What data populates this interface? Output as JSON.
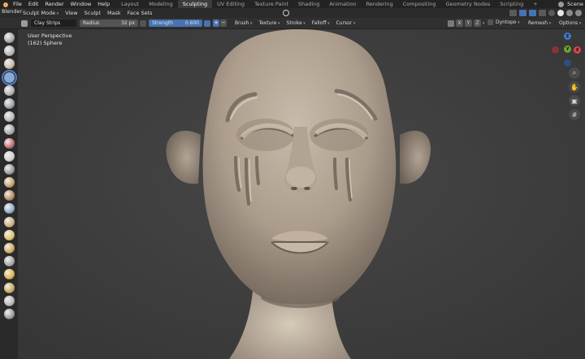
{
  "app": {
    "name": "Blender",
    "scene_label": "Scene"
  },
  "menubar": {
    "items": [
      "File",
      "Edit",
      "Render",
      "Window",
      "Help"
    ],
    "workspaces": [
      "Layout",
      "Modeling",
      "Sculpting",
      "UV Editing",
      "Texture Paint",
      "Shading",
      "Animation",
      "Rendering",
      "Compositing",
      "Geometry Nodes",
      "Scripting"
    ],
    "active_workspace": "Sculpting",
    "add_tab": "+"
  },
  "header": {
    "mode": "Sculpt Mode",
    "menus": [
      "View",
      "Sculpt",
      "Mask",
      "Face Sets"
    ]
  },
  "toolsettings": {
    "brush_name": "Clay Strips",
    "radius_label": "Radius",
    "radius_value": "32 px",
    "strength_label": "Strength",
    "strength_value": "0.600",
    "plus": "+",
    "minus": "−",
    "menus": [
      "Brush",
      "Texture",
      "Stroke",
      "Falloff",
      "Cursor"
    ],
    "symmetry": [
      "X",
      "Y",
      "Z"
    ],
    "dyntopo_label": "Dyntopo",
    "remesh_label": "Remesh",
    "options_label": "Options"
  },
  "viewport": {
    "perspective": "User Perspective",
    "object": "(162) Sphere",
    "background": "#3e3e3e",
    "mesh_color": "#b7a898"
  },
  "gizmo": {
    "x_label": "X",
    "y_label": "Y",
    "z_label": "Z",
    "x_color": "#d9464a",
    "y_color": "#6ea52d",
    "z_color": "#3d79c9"
  },
  "tools": [
    "draw",
    "draw-sharp",
    "clay",
    "clay-strips",
    "clay-thumb",
    "layer",
    "inflate",
    "blob",
    "crease",
    "smooth",
    "flatten",
    "fill",
    "scrape",
    "multiplane-scrape",
    "pinch",
    "grab",
    "elastic-deform",
    "snake-hook",
    "thumb",
    "pose",
    "nudge",
    "rotate"
  ]
}
